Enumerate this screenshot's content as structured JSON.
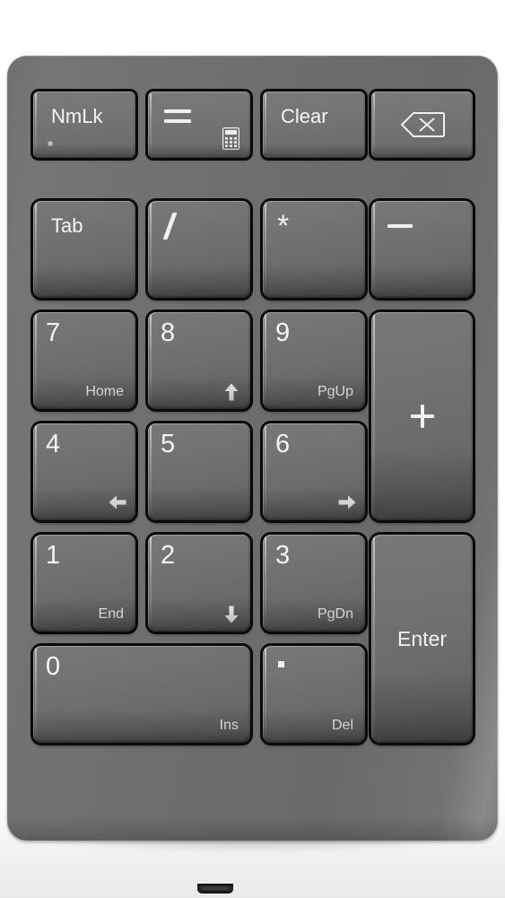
{
  "device": {
    "name": "numeric-keypad",
    "body_color": "#6d6d6d",
    "key_color": "#727272",
    "legend_color": "#f2f2f2",
    "bezel_color": "#0a0a0a"
  },
  "rows": [
    {
      "name": "function-row",
      "keys": [
        {
          "id": "numlock",
          "primary": "NmLk",
          "secondary": "",
          "icon": "",
          "indicator": "led",
          "align": "fn",
          "span": 1
        },
        {
          "id": "equals",
          "primary": "=",
          "secondary": "",
          "icon": "calculator-icon",
          "indicator": "",
          "align": "glyph-equals",
          "span": 1
        },
        {
          "id": "clear",
          "primary": "Clear",
          "secondary": "",
          "icon": "",
          "indicator": "",
          "align": "fn",
          "span": 1
        },
        {
          "id": "backspace",
          "primary": "",
          "secondary": "",
          "icon": "backspace-icon",
          "indicator": "",
          "align": "icon-center",
          "span": 1
        }
      ]
    },
    {
      "name": "row-tab",
      "keys": [
        {
          "id": "tab",
          "primary": "Tab",
          "secondary": "",
          "icon": "",
          "indicator": "",
          "align": "fn",
          "span": 1
        },
        {
          "id": "divide",
          "primary": "/",
          "secondary": "",
          "icon": "",
          "indicator": "",
          "align": "glyph-slash",
          "span": 1
        },
        {
          "id": "multiply",
          "primary": "*",
          "secondary": "",
          "icon": "",
          "indicator": "",
          "align": "glyph-asterisk",
          "span": 1
        },
        {
          "id": "minus",
          "primary": "−",
          "secondary": "",
          "icon": "",
          "indicator": "",
          "align": "glyph-minus",
          "span": 1
        }
      ]
    },
    {
      "name": "row-789",
      "keys": [
        {
          "id": "num7",
          "primary": "7",
          "secondary": "Home",
          "icon": "",
          "indicator": "",
          "align": "num",
          "span": 1
        },
        {
          "id": "num8",
          "primary": "8",
          "secondary": "",
          "icon": "arrow-up-icon",
          "indicator": "",
          "align": "num",
          "span": 1
        },
        {
          "id": "num9",
          "primary": "9",
          "secondary": "PgUp",
          "icon": "",
          "indicator": "",
          "align": "num",
          "span": 1
        },
        {
          "id": "plus",
          "primary": "+",
          "secondary": "",
          "icon": "",
          "indicator": "",
          "align": "glyph-plus",
          "span": 1
        }
      ]
    },
    {
      "name": "row-456",
      "keys": [
        {
          "id": "num4",
          "primary": "4",
          "secondary": "",
          "icon": "arrow-left-icon",
          "indicator": "",
          "align": "num",
          "span": 1
        },
        {
          "id": "num5",
          "primary": "5",
          "secondary": "",
          "icon": "",
          "indicator": "",
          "align": "num",
          "span": 1
        },
        {
          "id": "num6",
          "primary": "6",
          "secondary": "",
          "icon": "arrow-right-icon",
          "indicator": "",
          "align": "num",
          "span": 1
        }
      ]
    },
    {
      "name": "row-123",
      "keys": [
        {
          "id": "num1",
          "primary": "1",
          "secondary": "End",
          "icon": "",
          "indicator": "",
          "align": "num",
          "span": 1
        },
        {
          "id": "num2",
          "primary": "2",
          "secondary": "",
          "icon": "arrow-down-icon",
          "indicator": "",
          "align": "num",
          "span": 1
        },
        {
          "id": "num3",
          "primary": "3",
          "secondary": "PgDn",
          "icon": "",
          "indicator": "",
          "align": "num",
          "span": 1
        },
        {
          "id": "enter",
          "primary": "Enter",
          "secondary": "",
          "icon": "",
          "indicator": "",
          "align": "center",
          "span": 1
        }
      ]
    },
    {
      "name": "row-zero",
      "keys": [
        {
          "id": "num0",
          "primary": "0",
          "secondary": "Ins",
          "icon": "",
          "indicator": "",
          "align": "num",
          "span": 2
        },
        {
          "id": "decimal",
          "primary": ".",
          "secondary": "Del",
          "icon": "",
          "indicator": "dot-square",
          "align": "num",
          "span": 1
        }
      ]
    }
  ],
  "labels": {
    "numlock": "NmLk",
    "equals": "=",
    "clear": "Clear",
    "backspace": "",
    "tab": "Tab",
    "divide": "/",
    "multiply": "*",
    "minus": "−",
    "num7": "7",
    "num7_alt": "Home",
    "num8": "8",
    "num9": "9",
    "num9_alt": "PgUp",
    "plus": "+",
    "num4": "4",
    "num5": "5",
    "num6": "6",
    "num1": "1",
    "num1_alt": "End",
    "num2": "2",
    "num3": "3",
    "num3_alt": "PgDn",
    "enter": "Enter",
    "num0": "0",
    "num0_alt": "Ins",
    "decimal_alt": "Del"
  }
}
